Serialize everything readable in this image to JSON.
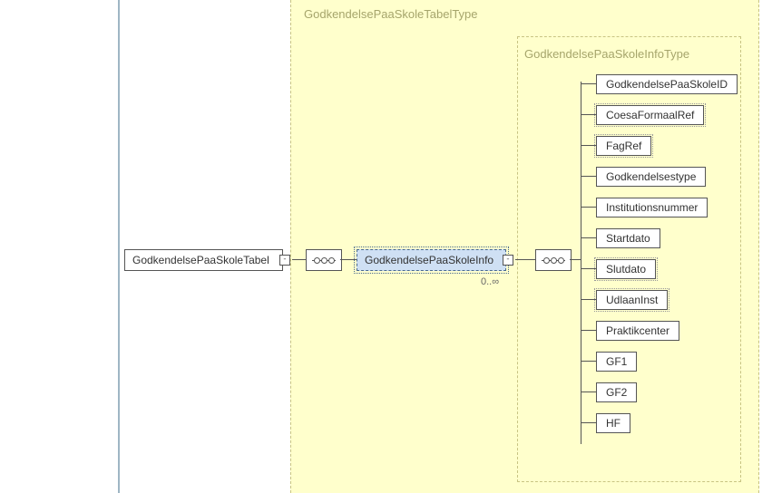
{
  "root": {
    "label": "GodkendelsePaaSkoleTabel"
  },
  "info": {
    "label": "GodkendelsePaaSkoleInfo",
    "occurrence": "0..∞"
  },
  "regionType": "GodkendelsePaaSkoleTabelType",
  "innerType": "GodkendelsePaaSkoleInfoType",
  "children": [
    {
      "label": "GodkendelsePaaSkoleID",
      "optional": false
    },
    {
      "label": "CoesaFormaalRef",
      "optional": true
    },
    {
      "label": "FagRef",
      "optional": true
    },
    {
      "label": "Godkendelsestype",
      "optional": false
    },
    {
      "label": "Institutionsnummer",
      "optional": false
    },
    {
      "label": "Startdato",
      "optional": false
    },
    {
      "label": "Slutdato",
      "optional": true
    },
    {
      "label": "UdlaanInst",
      "optional": true
    },
    {
      "label": "Praktikcenter",
      "optional": false
    },
    {
      "label": "GF1",
      "optional": false
    },
    {
      "label": "GF2",
      "optional": false
    },
    {
      "label": "HF",
      "optional": false
    }
  ]
}
